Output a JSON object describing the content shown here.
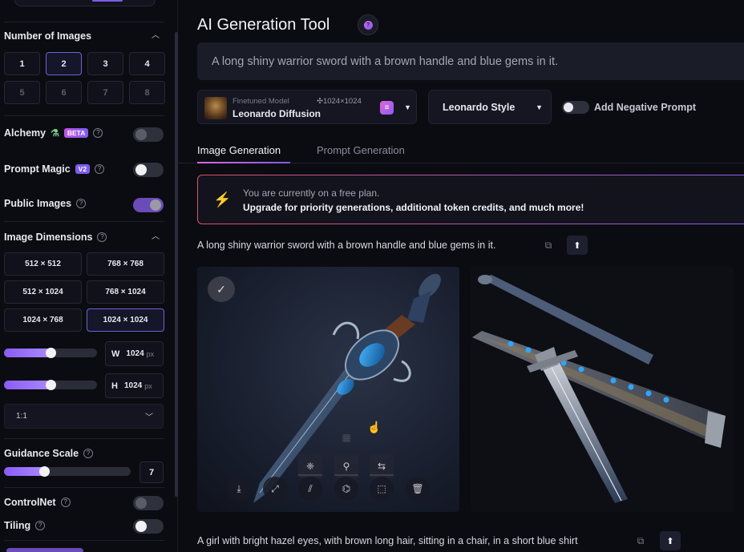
{
  "sidebar": {
    "number_of_images": {
      "title": "Number of Images",
      "options": [
        "1",
        "2",
        "3",
        "4",
        "5",
        "6",
        "7",
        "8"
      ],
      "selected": "2"
    },
    "alchemy": {
      "label": "Alchemy",
      "badge": "BETA",
      "enabled": false
    },
    "prompt_magic": {
      "label": "Prompt Magic",
      "badge": "V2",
      "enabled": true
    },
    "public_images": {
      "label": "Public Images",
      "enabled": true
    },
    "image_dimensions": {
      "title": "Image Dimensions",
      "options": [
        "512 × 512",
        "768 × 768",
        "512 × 1024",
        "768 × 1024",
        "1024 × 768",
        "1024 × 1024"
      ],
      "selected": "1024 × 1024"
    },
    "width": {
      "label": "W",
      "value": "1024",
      "unit": "px",
      "slider_fraction": 0.5
    },
    "height": {
      "label": "H",
      "value": "1024",
      "unit": "px",
      "slider_fraction": 0.5
    },
    "aspect_ratio": "1:1",
    "guidance_scale": {
      "label": "Guidance Scale",
      "value": "7",
      "slider_fraction": 0.3
    },
    "controlnet": {
      "label": "ControlNet",
      "enabled": false
    },
    "tiling": {
      "label": "Tiling",
      "enabled": false
    }
  },
  "main": {
    "title": "AI Generation Tool",
    "help_icon": "?",
    "prompt": "A long shiny warrior sword with a brown handle and blue gems in it.",
    "model": {
      "subtitle": "Finetuned Model",
      "name": "Leonardo Diffusion",
      "resolution": "✣1024×1024"
    },
    "style": "Leonardo Style",
    "negative_prompt": {
      "label": "Add Negative Prompt",
      "enabled": false
    },
    "tabs": [
      "Image Generation",
      "Prompt Generation"
    ],
    "active_tab": "Image Generation",
    "notice": {
      "line1": "You are currently on a free plan.",
      "line2": "Upgrade for priority generations, additional token credits, and much more!"
    },
    "generation": {
      "prompt": "A long shiny warrior sword with a brown handle and blue gems in it."
    },
    "next_generation": {
      "prompt": "A girl with bright hazel eyes, with brown long hair, sitting in a chair, in a short blue shirt"
    }
  },
  "colors": {
    "accent_purple": "#7d5cf0",
    "accent_pink": "#e067d8",
    "notice_orange": "#f08a2a"
  },
  "icons": [
    "help-icon",
    "chevron-up-icon",
    "chevron-down-icon",
    "potion-icon",
    "bolt-icon",
    "copy-icon",
    "arrow-up-icon",
    "check-icon",
    "download-icon",
    "expand-icon",
    "remove-bg-icon",
    "upscale-icon",
    "variations-icon",
    "swap-icon",
    "crop-icon",
    "trash-icon",
    "brush-icon"
  ]
}
